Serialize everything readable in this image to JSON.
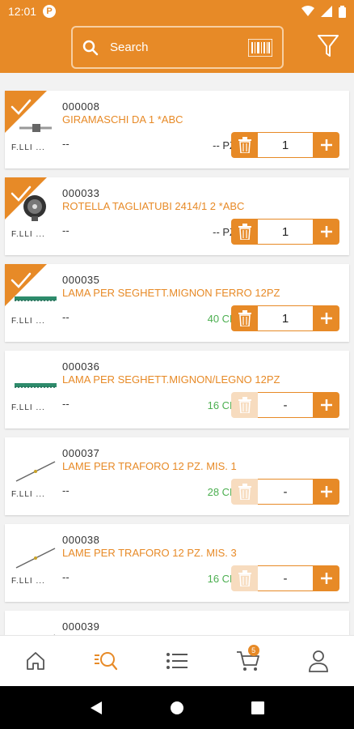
{
  "status": {
    "time": "12:01",
    "app_badge": "P"
  },
  "search": {
    "placeholder": "Search"
  },
  "products": [
    {
      "code": "000008",
      "name": "GIRAMASCHI DA 1 *ABC",
      "brand": "F.LLI ...",
      "extra": "--",
      "stock": "-- PZ",
      "stock_color": "#333333",
      "qty": "1",
      "selected": true,
      "image": "wrench-tool"
    },
    {
      "code": "000033",
      "name": "ROTELLA TAGLIATUBI 2414/1  2  *ABC",
      "brand": "F.LLI ...",
      "extra": "--",
      "stock": "-- PZ",
      "stock_color": "#333333",
      "qty": "1",
      "selected": true,
      "image": "cutter-wheel"
    },
    {
      "code": "000035",
      "name": "LAMA PER SEGHETT.MIGNON FERRO 12PZ",
      "brand": "F.LLI ...",
      "extra": "--",
      "stock": "40 CF",
      "stock_color": "#4caf50",
      "qty": "1",
      "selected": true,
      "image": "saw-blade"
    },
    {
      "code": "000036",
      "name": "LAMA PER SEGHETT.MIGNON/LEGNO 12PZ",
      "brand": "F.LLI ...",
      "extra": "--",
      "stock": "16 CF",
      "stock_color": "#4caf50",
      "qty": "-",
      "selected": false,
      "image": "saw-blade"
    },
    {
      "code": "000037",
      "name": "LAME PER TRAFORO 12 PZ. MIS. 1",
      "brand": "F.LLI ...",
      "extra": "--",
      "stock": "28 CF",
      "stock_color": "#4caf50",
      "qty": "-",
      "selected": false,
      "image": "fret-blade"
    },
    {
      "code": "000038",
      "name": "LAME PER TRAFORO 12 PZ. MIS. 3",
      "brand": "F.LLI ...",
      "extra": "--",
      "stock": "16 CF",
      "stock_color": "#4caf50",
      "qty": "-",
      "selected": false,
      "image": "fret-blade"
    },
    {
      "code": "000039",
      "name": "",
      "brand": "",
      "extra": "",
      "stock": "",
      "stock_color": "#333333",
      "qty": "",
      "selected": false,
      "image": "fret-blade"
    }
  ],
  "nav": {
    "cart_count": "5",
    "active": "search-catalog"
  },
  "colors": {
    "accent": "#e78a27",
    "accent_light": "#f7dcbf",
    "in_stock": "#4caf50"
  }
}
